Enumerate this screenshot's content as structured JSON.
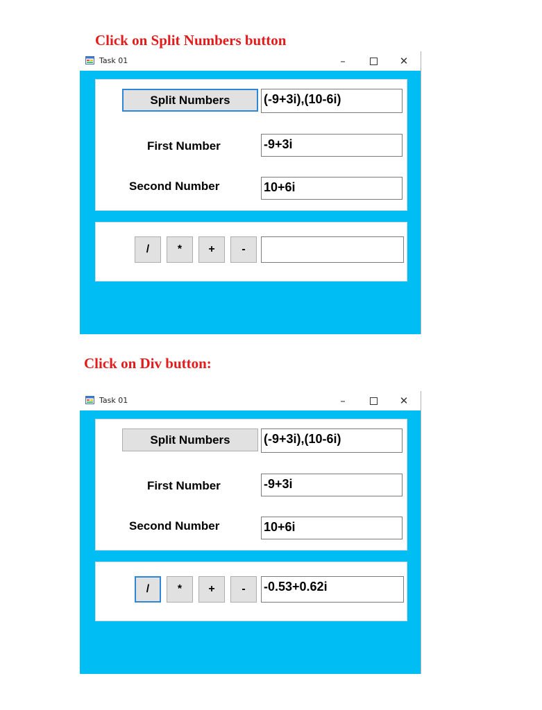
{
  "captions": {
    "first": "Click on Split Numbers button",
    "second": "Click on Div button:"
  },
  "window": {
    "title": "Task 01",
    "minimize_glyph": "–",
    "close_glyph": "✕"
  },
  "icons": {
    "app": "app-form-icon",
    "minimize": "minimize-icon",
    "maximize": "maximize-icon",
    "close": "close-icon"
  },
  "colors": {
    "caption": "#e31b1b",
    "client_background": "#00bdf4",
    "button_face": "#e1e1e1",
    "focus_border": "#2d86d6"
  },
  "form": {
    "split_button_label": "Split Numbers",
    "first_label": "First Number",
    "second_label": "Second Number",
    "ops": {
      "div": "/",
      "mul": "*",
      "add": "+",
      "sub": "-"
    }
  },
  "screens": [
    {
      "combined_value": "(-9+3i),(10-6i)",
      "first_value": "-9+3i",
      "second_value": "10+6i",
      "result_value": ""
    },
    {
      "combined_value": "(-9+3i),(10-6i)",
      "first_value": "-9+3i",
      "second_value": "10+6i",
      "result_value": "-0.53+0.62i"
    }
  ]
}
